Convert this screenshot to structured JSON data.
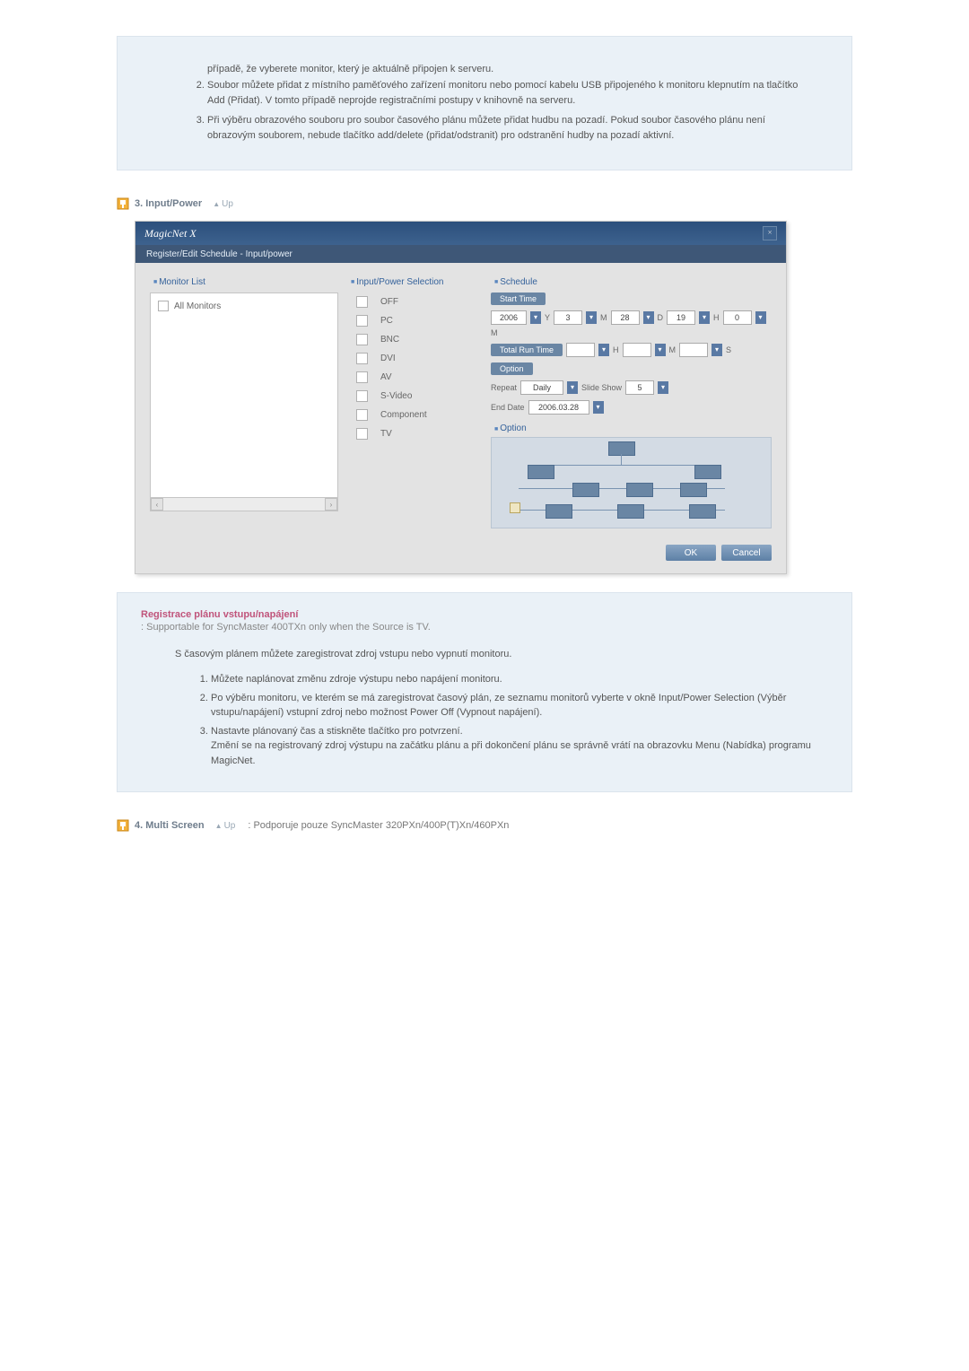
{
  "top_ol_start": 2,
  "top_items": [
    "případě, že vyberete monitor, který je aktuálně připojen k serveru.\nSoubor můžete přidat z místního paměťového zařízení monitoru nebo pomocí kabelu USB připojeného k monitoru klepnutím na tlačítko Add (Přidat). V tomto případě neprojde registračními postupy v knihovně na serveru.",
    "Při výběru obrazového souboru pro soubor časového plánu můžete přidat hudbu na pozadí. Pokud soubor časového plánu není obrazovým souborem, nebude tlačítko add/delete (přidat/odstranit) pro odstranění hudby na pozadí aktivní."
  ],
  "section3": {
    "title": "3. Input/Power",
    "up": "Up"
  },
  "window": {
    "app_title": "MagicNet X",
    "subtitle": "Register/Edit Schedule - Input/power",
    "monitor_header": "Monitor List",
    "all_monitors": "All Monitors",
    "input_header": "Input/Power Selection",
    "inputs": [
      "OFF",
      "PC",
      "BNC",
      "DVI",
      "AV",
      "S-Video",
      "Component",
      "TV"
    ],
    "schedule_header": "Schedule",
    "start_time": "Start Time",
    "year": "2006",
    "y": "Y",
    "mo": "3",
    "mo_l": "M",
    "day": "28",
    "day_l": "D",
    "hr": "19",
    "hr_l": "H",
    "mn": "0",
    "mn_l": "M",
    "total_run": "Total Run Time",
    "h": "H",
    "m": "M",
    "s": "S",
    "option_btn": "Option",
    "repeat_l": "Repeat",
    "repeat_v": "Daily",
    "slide_l": "Slide Show",
    "slide_v": "5",
    "end_l": "End Date",
    "end_v": "2006.03.28",
    "option_h": "Option",
    "ok": "OK",
    "cancel": "Cancel"
  },
  "desc": {
    "title": "Registrace plánu vstupu/napájení",
    "sub": ": Supportable for SyncMaster 400TXn only when the Source is TV.",
    "note": "S časovým plánem můžete zaregistrovat zdroj vstupu nebo vypnutí monitoru.",
    "items": [
      "Můžete naplánovat změnu zdroje výstupu nebo napájení monitoru.",
      "Po výběru monitoru, ve kterém se má zaregistrovat časový plán, ze seznamu monitorů vyberte v okně Input/Power Selection (Výběr vstupu/napájení) vstupní zdroj nebo možnost Power Off (Vypnout napájení).",
      "Nastavte plánovaný čas a stiskněte tlačítko pro potvrzení.\nZmění se na registrovaný zdroj výstupu na začátku plánu a při dokončení plánu se správně vrátí na obrazovku Menu (Nabídka) programu MagicNet."
    ]
  },
  "section4": {
    "title": "4. Multi Screen",
    "up": "Up",
    "note": ": Podporuje pouze SyncMaster 320PXn/400P(T)Xn/460PXn"
  }
}
